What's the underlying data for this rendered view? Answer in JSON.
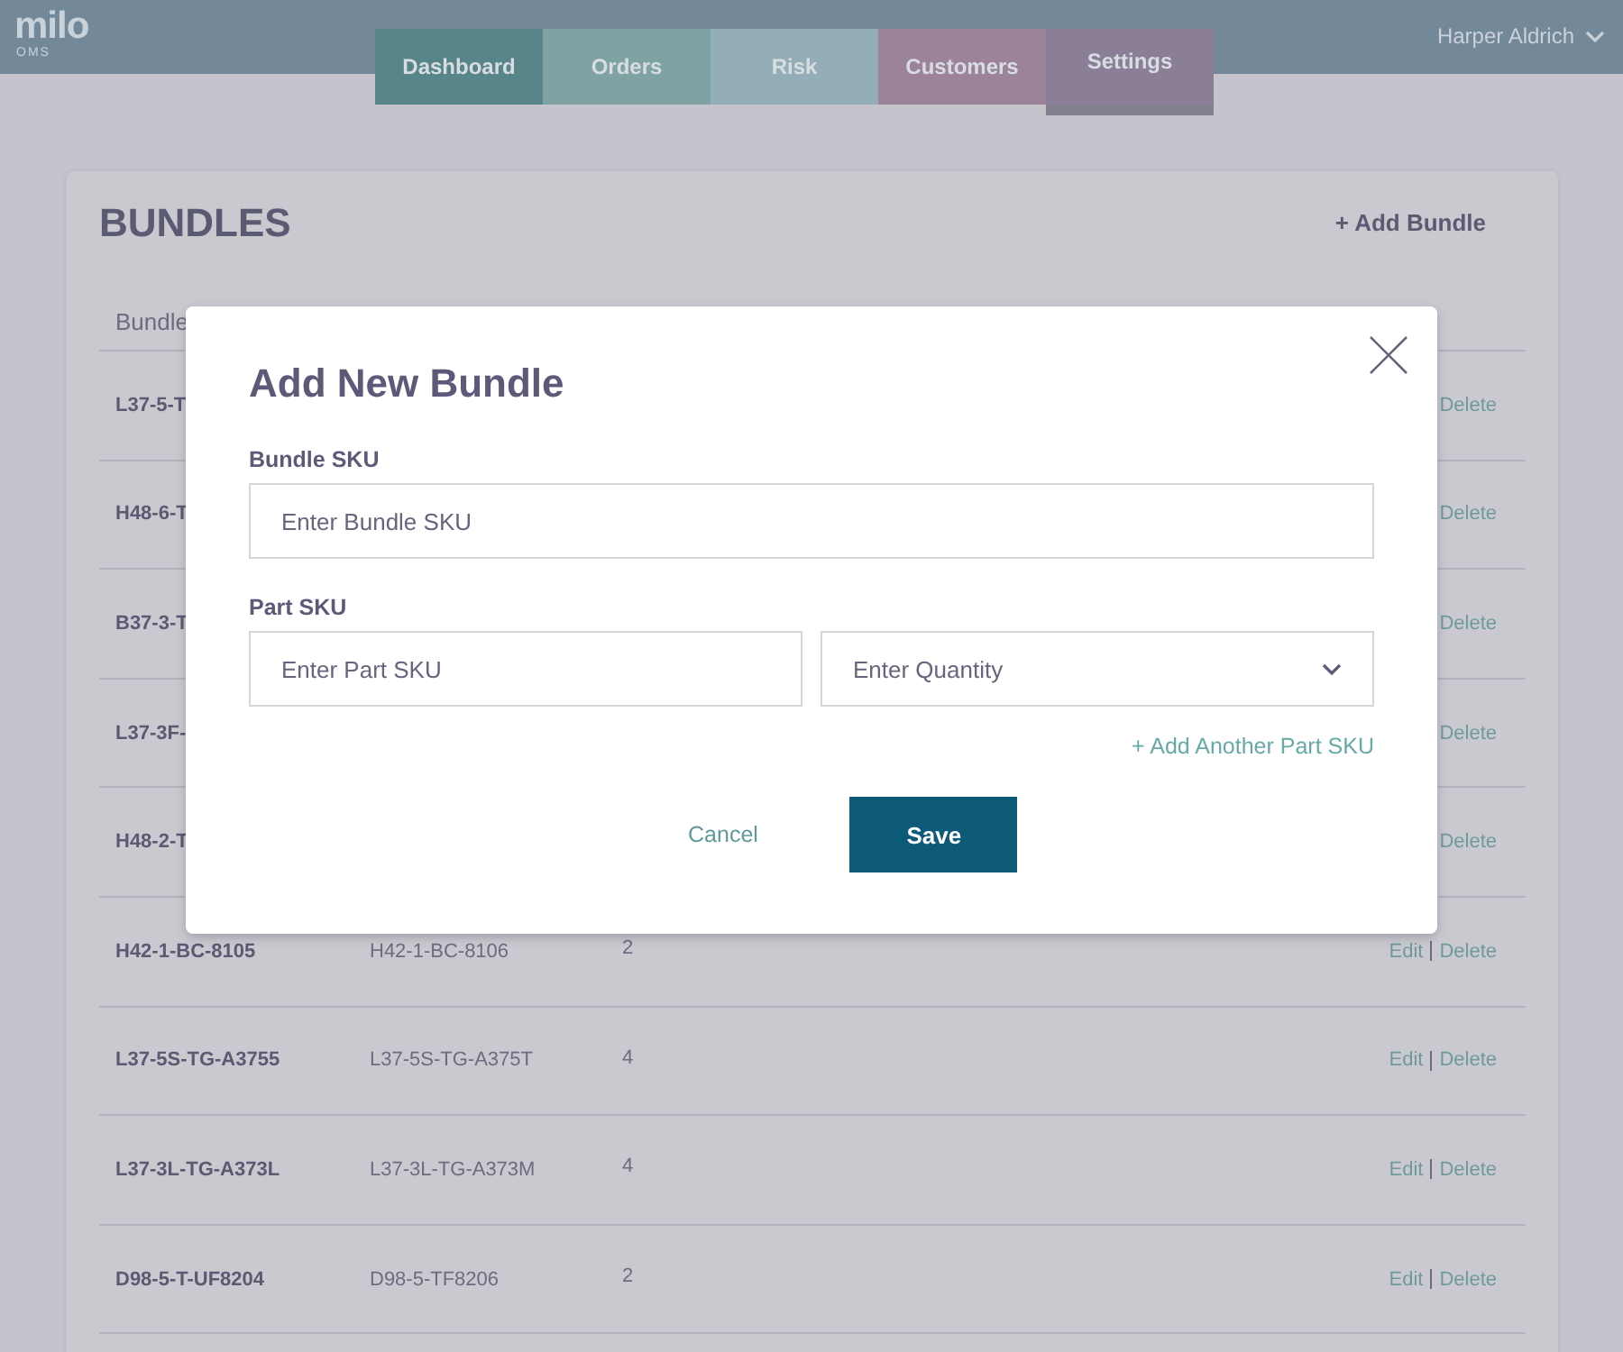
{
  "header": {
    "logo": "milo",
    "logo_sub": "OMS",
    "user": "Harper Aldrich"
  },
  "tabs": [
    {
      "label": "Dashboard",
      "selected": false,
      "color": "#57858a"
    },
    {
      "label": "Orders",
      "selected": false,
      "color": "#7fa2a2"
    },
    {
      "label": "Risk",
      "selected": false,
      "color": "#93aeb7"
    },
    {
      "label": "Customers",
      "selected": false,
      "color": "#9c8399"
    },
    {
      "label": "Settings",
      "selected": true,
      "color": "#8a7f97"
    }
  ],
  "bundles": {
    "title": "BUNDLES",
    "add_button": "+ Add Bundle",
    "columns": [
      "Bundle"
    ],
    "rows": [
      {
        "bundle_sku": "L37-5-T",
        "actions": [
          "Delete"
        ]
      },
      {
        "bundle_sku": "H48-6-T",
        "actions": [
          "Delete"
        ]
      },
      {
        "bundle_sku": "B37-3-T",
        "actions": [
          "Delete"
        ]
      },
      {
        "bundle_sku": "L37-3F-",
        "actions": [
          "Delete"
        ]
      },
      {
        "bundle_sku": "H48-2-T",
        "actions": [
          "Delete"
        ]
      },
      {
        "bundle_sku": "H42-1-BC-8105",
        "part_sku": "H42-1-BC-8106",
        "quantity": "2",
        "actions": [
          "Edit",
          "Delete"
        ]
      },
      {
        "bundle_sku": "L37-5S-TG-A3755",
        "part_sku": "L37-5S-TG-A375T",
        "quantity": "4",
        "actions": [
          "Edit",
          "Delete"
        ]
      },
      {
        "bundle_sku": "L37-3L-TG-A373L",
        "part_sku": "L37-3L-TG-A373M",
        "quantity": "4",
        "actions": [
          "Edit",
          "Delete"
        ]
      },
      {
        "bundle_sku": "D98-5-T-UF8204",
        "part_sku": "D98-5-TF8206",
        "quantity": "2",
        "actions": [
          "Edit",
          "Delete"
        ]
      }
    ]
  },
  "modal": {
    "title": "Add New Bundle",
    "bundle_label": "Bundle SKU",
    "bundle_placeholder": "Enter Bundle SKU",
    "part_label": "Part SKU",
    "part_placeholder": "Enter Part SKU",
    "quantity_placeholder": "Enter Quantity",
    "add_part_link": "+ Add Another Part SKU",
    "cancel": "Cancel",
    "save": "Save"
  }
}
